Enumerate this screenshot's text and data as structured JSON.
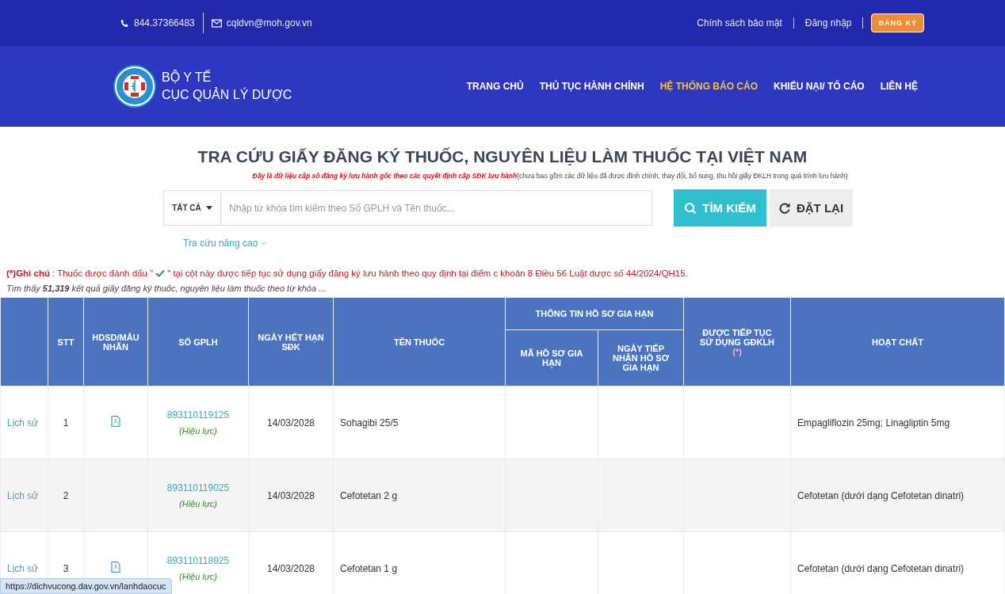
{
  "top_bar": {
    "phone": "844.37366483",
    "email": "cqldvn@moh.gov.vn",
    "links": [
      "Chính sách bảo mật",
      "Đăng nhập"
    ],
    "register_button": "ĐĂNG KÝ"
  },
  "header": {
    "org_line_1": "BỘ Y TẾ",
    "org_line_2": "CỤC QUẢN LÝ DƯỢC",
    "nav": [
      {
        "label": "TRANG CHỦ",
        "selected": false
      },
      {
        "label": "THỦ TỤC HÀNH CHÍNH",
        "selected": false
      },
      {
        "label": "HỆ THỐNG BÁO CÁO",
        "selected": true
      },
      {
        "label": "KHIẾU NẠI/ TỐ CÁO",
        "selected": false
      },
      {
        "label": "LIÊN HỆ",
        "selected": false
      }
    ]
  },
  "title": "TRA CỨU GIẤY ĐĂNG KÝ THUỐC, NGUYÊN LIỆU LÀM THUỐC TẠI VIỆT NAM",
  "subtitle": {
    "highlight": "Đây là dữ liệu cấp số đăng ký lưu hành gốc theo các quyết định cấp SĐK lưu hành",
    "rest": "(chưa bao gồm các dữ liệu đã được đính chính, thay đổi, bổ sung, thu hồi giấy ĐKLH trong quá trình lưu hành)"
  },
  "search": {
    "scope": "TẤT CẢ",
    "placeholder": "Nhập từ khóa tìm kiếm theo Số GPLH và Tên thuốc...",
    "search_button": "TÌM KIẾM",
    "reset_button": "ĐẶT LẠI",
    "advanced_link": "Tra cứu nâng cao"
  },
  "note": {
    "label": "(*)Ghi chú",
    "before": ": Thuốc được đánh dấu \"",
    "after": "\" tại cột này được tiếp tục sử dụng giấy đăng ký lưu hành theo quy định tại điểm c khoản 8 Điều 56 Luật dược số 44/2024/QH15."
  },
  "result_summary": "Tìm thấy **51,319** kết quả giấy đăng ký thuốc, nguyên liệu làm thuốc theo từ khóa ...",
  "table": {
    "columns": {
      "stt": "STT",
      "hdsd": "HDSD/MẪU NHÃN",
      "number": "SỐ GPLH",
      "expiry": "NGÀY HẾT HẠN SĐK",
      "name": "TÊN THUỐC",
      "renewal_group": "THÔNG TIN HỒ SƠ GIA HẠN",
      "renewal_code": "MÃ HỒ SƠ GIA HẠN",
      "renewal_date": "NGÀY TIẾP NHẬN HỒ SƠ GIA HẠN",
      "continued": "ĐƯỢC TIẾP TỤC SỬ DỤNG GĐKLH",
      "continued_marker": "(*)",
      "ingredient": "HOẠT CHẤT"
    },
    "rows": [
      {
        "history": "Lịch sử",
        "stt": "1",
        "has_document": true,
        "number": "893110119125",
        "status": "(Hiệu lực)",
        "expiry": "14/03/2028",
        "name": "Sohagibi 25/5",
        "ingredient": "Empagliflozin 25mg; Linagliptin 5mg"
      },
      {
        "history": "Lịch sử",
        "stt": "2",
        "has_document": false,
        "number": "893110119025",
        "status": "(Hiệu lực)",
        "expiry": "14/03/2028",
        "name": "Cefotetan 2 g",
        "ingredient": "Cefotetan (dưới dạng Cefotetan dinatri)"
      },
      {
        "history": "Lịch sử",
        "stt": "3",
        "has_document": true,
        "number": "893110118925",
        "status": "(Hiệu lực)",
        "expiry": "14/03/2028",
        "name": "Cefotetan 1 g",
        "ingredient": "Cefotetan (dưới dạng Cefotetan dinatri)"
      }
    ]
  },
  "status_bar_url": "https://dichvucong.dav.gov.vn/lanhdaocuc"
}
